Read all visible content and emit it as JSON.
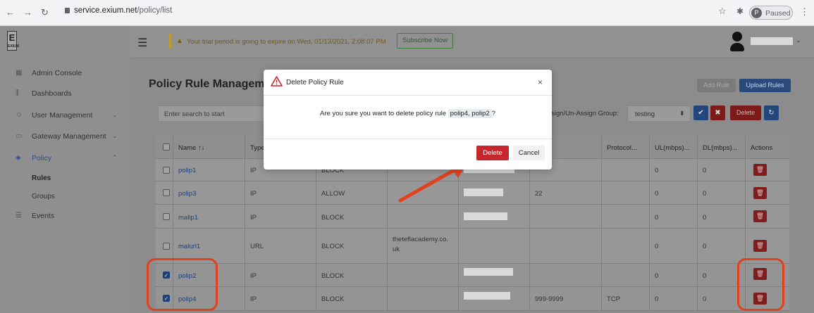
{
  "browser": {
    "url_host": "service.exium.net",
    "url_path": "/policy/list",
    "profile_status": "Paused",
    "profile_initial": "P"
  },
  "sidebar": {
    "logo_letter": "E",
    "logo_sub": "EXIUM",
    "items": [
      {
        "label": "Admin Console",
        "icon": "grid-icon"
      },
      {
        "label": "Dashboards",
        "icon": "bar-chart-icon"
      },
      {
        "label": "User Management",
        "icon": "users-icon",
        "expandable": true
      },
      {
        "label": "Gateway Management",
        "icon": "monitor-icon",
        "expandable": true
      },
      {
        "label": "Policy",
        "icon": "shield-icon",
        "expanded": true
      }
    ],
    "policy_sub": [
      "Rules",
      "Groups"
    ],
    "events_label": "Events"
  },
  "topbar": {
    "trial_message": "Your trial period is going to expire on Wed, 01/13/2021, 2:08:07 PM",
    "subscribe_label": "Subscribe Now"
  },
  "page": {
    "title": "Policy Rule Managem",
    "add_rule_label": "Add Rule",
    "upload_rules_label": "Upload Rules",
    "search_placeholder": "Enter search to start",
    "assign_label": "Assign/Un-Assign Group:",
    "assign_value": "testing",
    "delete_label": "Delete"
  },
  "table": {
    "headers": [
      "Name ↑↓",
      "Type",
      "",
      "",
      "",
      "↑↓",
      "Protocol...",
      "UL(mbps)...",
      "DL(mbps)...",
      "Actions"
    ],
    "rows": [
      {
        "name": "polip1",
        "type": "IP",
        "action": "BLOCK",
        "domain": "",
        "port": "",
        "protocol": "",
        "ul": "0",
        "dl": "0",
        "checked": false
      },
      {
        "name": "polip3",
        "type": "IP",
        "action": "ALLOW",
        "domain": "",
        "port": "22",
        "protocol": "",
        "ul": "0",
        "dl": "0",
        "checked": false
      },
      {
        "name": "malip1",
        "type": "IP",
        "action": "BLOCK",
        "domain": "",
        "port": "",
        "protocol": "",
        "ul": "0",
        "dl": "0",
        "checked": false
      },
      {
        "name": "malurl1",
        "type": "URL",
        "action": "BLOCK",
        "domain_line1": "theteflacademy.co.",
        "domain_line2": "uk",
        "port": "",
        "protocol": "",
        "ul": "0",
        "dl": "0",
        "checked": false
      },
      {
        "name": "polip2",
        "type": "IP",
        "action": "BLOCK",
        "domain": "",
        "port": "",
        "protocol": "",
        "ul": "0",
        "dl": "0",
        "checked": true
      },
      {
        "name": "polip4",
        "type": "IP",
        "action": "BLOCK",
        "domain": "",
        "port": "999-9999",
        "protocol": "TCP",
        "ul": "0",
        "dl": "0",
        "checked": true
      }
    ]
  },
  "modal": {
    "title": "Delete Policy Rule",
    "message_prefix": "Are you sure you want to delete policy rule",
    "rule_names": "polip4, polip2",
    "message_suffix": "?",
    "close_glyph": "×",
    "delete_label": "Delete",
    "cancel_label": "Cancel"
  },
  "colors": {
    "danger": "#c8262d",
    "annotation": "#e1411c",
    "primary": "#2a4a7c"
  }
}
